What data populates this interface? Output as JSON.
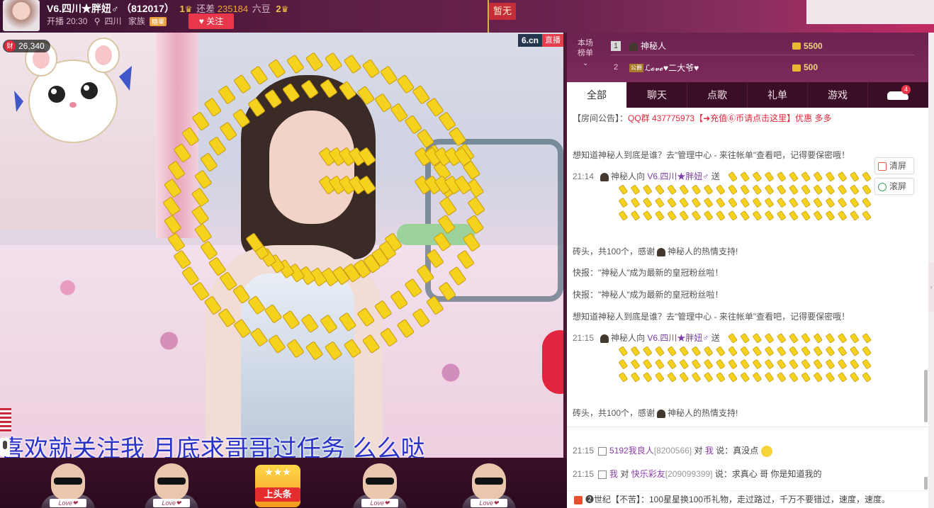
{
  "header": {
    "anchor_name": "V6.四川★胖妞♂",
    "room_id": "（812017）",
    "level_left": "1",
    "gap_label": "还差",
    "gap_value": "235184",
    "gap_unit": "六豆",
    "level_right": "2",
    "live_time": "开播 20:30",
    "location": "四川",
    "family_label": "家族",
    "family_badge": "糖果",
    "follow_label": "关注",
    "flag_text": "暂无"
  },
  "video": {
    "site_logo": "6.cn",
    "live_tag": "直播",
    "viewer_count": "26,340",
    "fortune_badge": "财",
    "scroll_text": "喜欢就关注我   月底求哥哥过任务   么么哒"
  },
  "gift_row": {
    "love_label": "Love❤",
    "headline_label": "上头条",
    "headline_stars": "★★★"
  },
  "rank": {
    "title_line1": "本场",
    "title_line2": "榜单",
    "rows": [
      {
        "no": "1",
        "name": "神秘人",
        "coins": "5500"
      },
      {
        "no": "2",
        "badge": "公爵",
        "name": "ℒ𝓸𝓿𝓮♥二大爷♥",
        "coins": "500"
      }
    ]
  },
  "tabs": {
    "items": [
      "全部",
      "聊天",
      "点歌",
      "礼单",
      "游戏"
    ],
    "car_count": "4"
  },
  "chat": {
    "notice_prefix": "【房间公告】：",
    "notice_body": "QQ群 437775973【➜充值⑥币请点击这里】优惠 多多",
    "tool_clear": "清屏",
    "tool_scroll": "滚屏",
    "msgs": {
      "tip1": "想知道神秘人到底是谁？去\"管理中心 - 来往帐单\"查看吧，记得要保密哦！",
      "gift1_time": "21:14",
      "gift_from": "神秘人向",
      "gift_to": "V6.四川★胖妞♂",
      "gift_send": "送",
      "gift_summary_a": "砖头，共100个，感谢",
      "gift_summary_b": "神秘人的热情支持!",
      "flash1": "快报：\"神秘人\"成为最新的皇冠粉丝啦！",
      "flash2": "快报：\"神秘人\"成为最新的皇冠粉丝啦！",
      "tip2": "想知道神秘人到底是谁？去\"管理中心 - 来往帐单\"查看吧，记得要保密哦！",
      "gift2_time": "21:15"
    }
  },
  "chat2": {
    "m1_time": "21:15",
    "m1_user": "5192我良人",
    "m1_id": "[8200566]",
    "m1_to": "对",
    "m1_target": "我",
    "m1_text": "说：真没点",
    "m2_time": "21:15",
    "m2_user": "我",
    "m2_to": "对",
    "m2_target": "快乐彩友",
    "m2_id": "[209099399]",
    "m2_text": "说：求真心 哥 你是知道我的"
  },
  "broadcast": {
    "text": "❷世纪【不苦】：100星星换100币礼物，走过路过，千万不要错过，速度，速度。"
  },
  "colors": {
    "accent": "#e8374a",
    "panel_bg": "#6b2350",
    "gift_yellow": "#f5d21e"
  }
}
